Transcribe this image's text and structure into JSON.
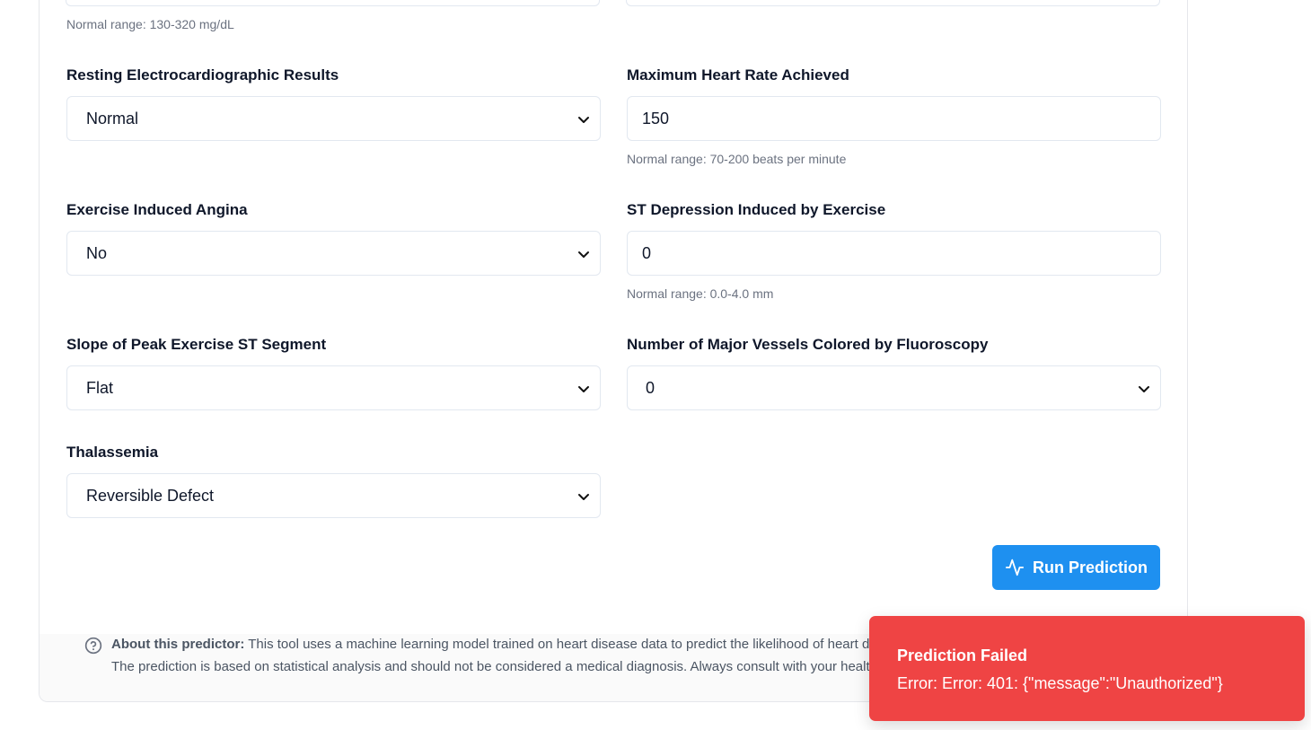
{
  "top_hint": "Normal range: 130-320 mg/dL",
  "fields": {
    "restecg": {
      "label": "Resting Electrocardiographic Results",
      "value": "Normal"
    },
    "thalach": {
      "label": "Maximum Heart Rate Achieved",
      "value": "150",
      "hint": "Normal range: 70-200 beats per minute"
    },
    "exang": {
      "label": "Exercise Induced Angina",
      "value": "No"
    },
    "oldpeak": {
      "label": "ST Depression Induced by Exercise",
      "value": "0",
      "hint": "Normal range: 0.0-4.0 mm"
    },
    "slope": {
      "label": "Slope of Peak Exercise ST Segment",
      "value": "Flat"
    },
    "ca": {
      "label": "Number of Major Vessels Colored by Fluoroscopy",
      "value": "0"
    },
    "thal": {
      "label": "Thalassemia",
      "value": "Reversible Defect"
    }
  },
  "run_button": {
    "label": "Run Prediction",
    "icon": "activity-icon"
  },
  "about": {
    "icon": "help-circle-icon",
    "title": "About this predictor:",
    "line1": "This tool uses a machine learning model trained on heart disease data to predict the likelihood of heart disease based on the provided parameters.",
    "line2": "The prediction is based on statistical analysis and should not be considered a medical diagnosis. Always consult with your healthcare provider."
  },
  "toast": {
    "title": "Prediction Failed",
    "message": "Error: Error: 401: {\"message\":\"Unauthorized\"}"
  },
  "colors": {
    "primary": "#1e90f0",
    "error": "#ef4444",
    "border": "#e2e8f0"
  }
}
